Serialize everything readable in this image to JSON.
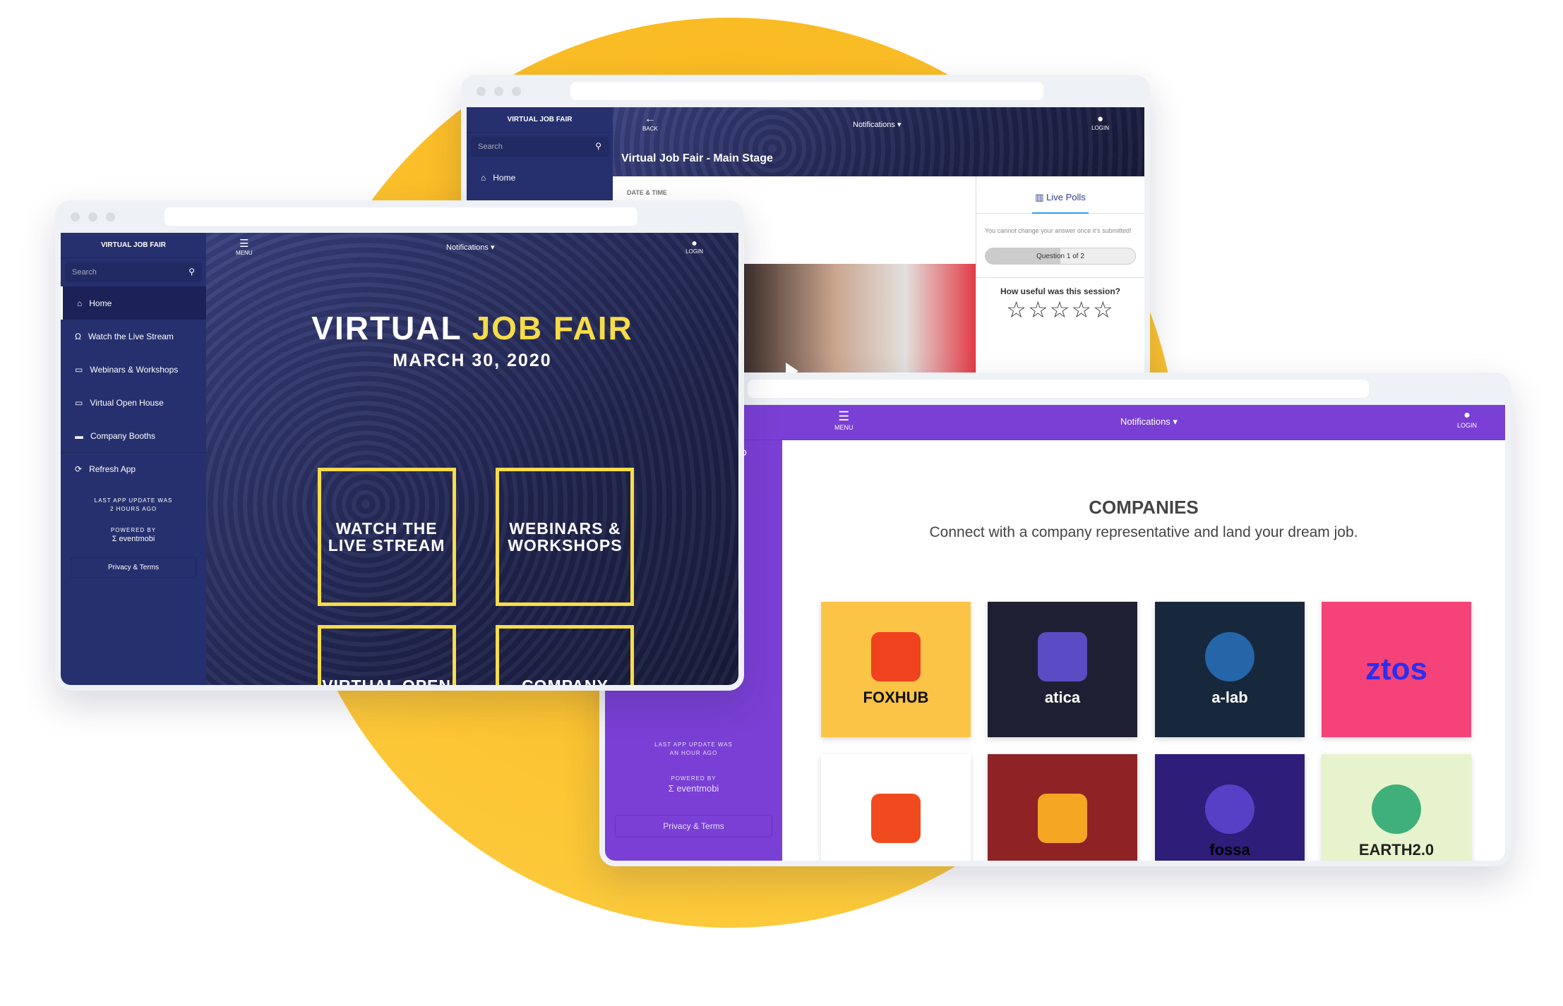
{
  "colors": {
    "accent_yellow": "#f9b214",
    "navy": "#27306e",
    "purple": "#7a3fd4",
    "tile_border": "#f7dc4a"
  },
  "main_stage": {
    "sidebar_title": "VIRTUAL JOB FAIR",
    "search_placeholder": "Search",
    "nav": [
      {
        "label": "Home",
        "icon": "home-icon"
      }
    ],
    "back_label": "BACK",
    "notifications": "Notifications",
    "login": "LOGIN",
    "title": "Virtual Job Fair - Main Stage",
    "date_label": "DATE & TIME",
    "polls_tab": "Live Polls",
    "poll_note": "You cannot change your answer once it's submitted!",
    "poll_progress": "Question 1 of 2",
    "poll_progress_fraction": 0.5,
    "question": "How useful was this session?",
    "stars": 5,
    "rating": 0
  },
  "home": {
    "sidebar_title": "VIRTUAL JOB FAIR",
    "search_placeholder": "Search",
    "nav": [
      {
        "label": "Home",
        "icon": "home-icon"
      },
      {
        "label": "Watch the Live Stream",
        "icon": "headphones-icon"
      },
      {
        "label": "Webinars & Workshops",
        "icon": "calendar-icon"
      },
      {
        "label": "Virtual Open House",
        "icon": "calendar-icon"
      },
      {
        "label": "Company Booths",
        "icon": "briefcase-icon"
      },
      {
        "label": "Refresh App",
        "icon": "refresh-icon"
      }
    ],
    "last_update_1": "LAST APP UPDATE WAS",
    "last_update_2": "2 HOURS AGO",
    "powered_by": "POWERED BY",
    "brand": "eventmobi",
    "privacy": "Privacy & Terms",
    "menu": "MENU",
    "notifications": "Notifications",
    "login": "LOGIN",
    "hero_title_1": "VIRTUAL",
    "hero_title_2": "JOB FAIR",
    "hero_date": "MARCH 30, 2020",
    "tiles": [
      "WATCH THE LIVE STREAM",
      "WEBINARS & WORKSHOPS",
      "VIRTUAL OPEN HOUSE",
      "COMPANY BOOTHS"
    ]
  },
  "companies": {
    "menu": "MENU",
    "notifications": "Notifications",
    "login": "LOGIN",
    "last_update_1": "LAST APP UPDATE WAS",
    "last_update_2": "AN HOUR AGO",
    "powered_by": "POWERED BY",
    "brand": "eventmobi",
    "privacy": "Privacy & Terms",
    "title": "COMPANIES",
    "subtitle": "Connect with a company representative and land your dream job.",
    "logos": [
      {
        "name": "FOXHUB",
        "bg": "#fcc447",
        "fg": "#111"
      },
      {
        "name": "atica",
        "bg": "#1f1f33",
        "fg": "#fff"
      },
      {
        "name": "a-lab",
        "bg": "#17283d",
        "fg": "#fff"
      },
      {
        "name": "ztos",
        "bg": "#f54279",
        "fg": "#2a2ef0"
      },
      {
        "name": "",
        "bg": "#ffffff",
        "fg": "#f24a1f"
      },
      {
        "name": "",
        "bg": "#8e2224",
        "fg": "#f5a623"
      },
      {
        "name": "fossa",
        "bg": "#2e1e7a",
        "fg": "#000"
      },
      {
        "name": "EARTH2.0",
        "bg": "#e7f3cc",
        "fg": "#222"
      }
    ]
  }
}
